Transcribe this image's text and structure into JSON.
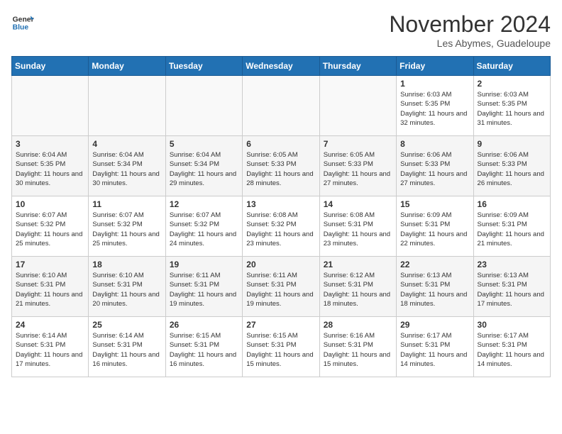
{
  "header": {
    "logo_line1": "General",
    "logo_line2": "Blue",
    "month": "November 2024",
    "location": "Les Abymes, Guadeloupe"
  },
  "weekdays": [
    "Sunday",
    "Monday",
    "Tuesday",
    "Wednesday",
    "Thursday",
    "Friday",
    "Saturday"
  ],
  "weeks": [
    [
      {
        "day": "",
        "info": ""
      },
      {
        "day": "",
        "info": ""
      },
      {
        "day": "",
        "info": ""
      },
      {
        "day": "",
        "info": ""
      },
      {
        "day": "",
        "info": ""
      },
      {
        "day": "1",
        "info": "Sunrise: 6:03 AM\nSunset: 5:35 PM\nDaylight: 11 hours and 32 minutes."
      },
      {
        "day": "2",
        "info": "Sunrise: 6:03 AM\nSunset: 5:35 PM\nDaylight: 11 hours and 31 minutes."
      }
    ],
    [
      {
        "day": "3",
        "info": "Sunrise: 6:04 AM\nSunset: 5:35 PM\nDaylight: 11 hours and 30 minutes."
      },
      {
        "day": "4",
        "info": "Sunrise: 6:04 AM\nSunset: 5:34 PM\nDaylight: 11 hours and 30 minutes."
      },
      {
        "day": "5",
        "info": "Sunrise: 6:04 AM\nSunset: 5:34 PM\nDaylight: 11 hours and 29 minutes."
      },
      {
        "day": "6",
        "info": "Sunrise: 6:05 AM\nSunset: 5:33 PM\nDaylight: 11 hours and 28 minutes."
      },
      {
        "day": "7",
        "info": "Sunrise: 6:05 AM\nSunset: 5:33 PM\nDaylight: 11 hours and 27 minutes."
      },
      {
        "day": "8",
        "info": "Sunrise: 6:06 AM\nSunset: 5:33 PM\nDaylight: 11 hours and 27 minutes."
      },
      {
        "day": "9",
        "info": "Sunrise: 6:06 AM\nSunset: 5:33 PM\nDaylight: 11 hours and 26 minutes."
      }
    ],
    [
      {
        "day": "10",
        "info": "Sunrise: 6:07 AM\nSunset: 5:32 PM\nDaylight: 11 hours and 25 minutes."
      },
      {
        "day": "11",
        "info": "Sunrise: 6:07 AM\nSunset: 5:32 PM\nDaylight: 11 hours and 25 minutes."
      },
      {
        "day": "12",
        "info": "Sunrise: 6:07 AM\nSunset: 5:32 PM\nDaylight: 11 hours and 24 minutes."
      },
      {
        "day": "13",
        "info": "Sunrise: 6:08 AM\nSunset: 5:32 PM\nDaylight: 11 hours and 23 minutes."
      },
      {
        "day": "14",
        "info": "Sunrise: 6:08 AM\nSunset: 5:31 PM\nDaylight: 11 hours and 23 minutes."
      },
      {
        "day": "15",
        "info": "Sunrise: 6:09 AM\nSunset: 5:31 PM\nDaylight: 11 hours and 22 minutes."
      },
      {
        "day": "16",
        "info": "Sunrise: 6:09 AM\nSunset: 5:31 PM\nDaylight: 11 hours and 21 minutes."
      }
    ],
    [
      {
        "day": "17",
        "info": "Sunrise: 6:10 AM\nSunset: 5:31 PM\nDaylight: 11 hours and 21 minutes."
      },
      {
        "day": "18",
        "info": "Sunrise: 6:10 AM\nSunset: 5:31 PM\nDaylight: 11 hours and 20 minutes."
      },
      {
        "day": "19",
        "info": "Sunrise: 6:11 AM\nSunset: 5:31 PM\nDaylight: 11 hours and 19 minutes."
      },
      {
        "day": "20",
        "info": "Sunrise: 6:11 AM\nSunset: 5:31 PM\nDaylight: 11 hours and 19 minutes."
      },
      {
        "day": "21",
        "info": "Sunrise: 6:12 AM\nSunset: 5:31 PM\nDaylight: 11 hours and 18 minutes."
      },
      {
        "day": "22",
        "info": "Sunrise: 6:13 AM\nSunset: 5:31 PM\nDaylight: 11 hours and 18 minutes."
      },
      {
        "day": "23",
        "info": "Sunrise: 6:13 AM\nSunset: 5:31 PM\nDaylight: 11 hours and 17 minutes."
      }
    ],
    [
      {
        "day": "24",
        "info": "Sunrise: 6:14 AM\nSunset: 5:31 PM\nDaylight: 11 hours and 17 minutes."
      },
      {
        "day": "25",
        "info": "Sunrise: 6:14 AM\nSunset: 5:31 PM\nDaylight: 11 hours and 16 minutes."
      },
      {
        "day": "26",
        "info": "Sunrise: 6:15 AM\nSunset: 5:31 PM\nDaylight: 11 hours and 16 minutes."
      },
      {
        "day": "27",
        "info": "Sunrise: 6:15 AM\nSunset: 5:31 PM\nDaylight: 11 hours and 15 minutes."
      },
      {
        "day": "28",
        "info": "Sunrise: 6:16 AM\nSunset: 5:31 PM\nDaylight: 11 hours and 15 minutes."
      },
      {
        "day": "29",
        "info": "Sunrise: 6:17 AM\nSunset: 5:31 PM\nDaylight: 11 hours and 14 minutes."
      },
      {
        "day": "30",
        "info": "Sunrise: 6:17 AM\nSunset: 5:31 PM\nDaylight: 11 hours and 14 minutes."
      }
    ]
  ]
}
